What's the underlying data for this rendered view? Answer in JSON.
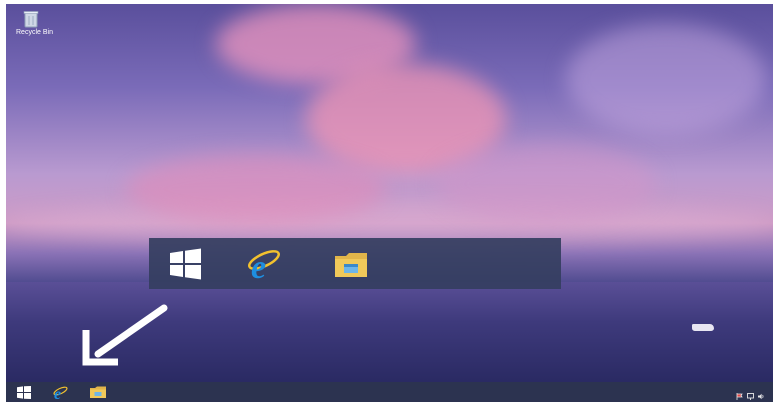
{
  "desktop": {
    "recycle_bin_label": "Recycle Bin"
  },
  "popup": {
    "icons": [
      "windows-icon",
      "internet-explorer-icon",
      "file-explorer-icon"
    ]
  },
  "taskbar": {
    "icons": [
      "windows-start-icon",
      "internet-explorer-icon",
      "file-explorer-icon"
    ],
    "tray_icons": [
      "action-center-flag-icon",
      "network-icon",
      "volume-icon"
    ]
  },
  "colors": {
    "taskbar": "#2c3350",
    "popup": "#343e5f",
    "ie_blue": "#1e8ee0",
    "ie_ring": "#f2c12e",
    "folder": "#f1c95a"
  }
}
